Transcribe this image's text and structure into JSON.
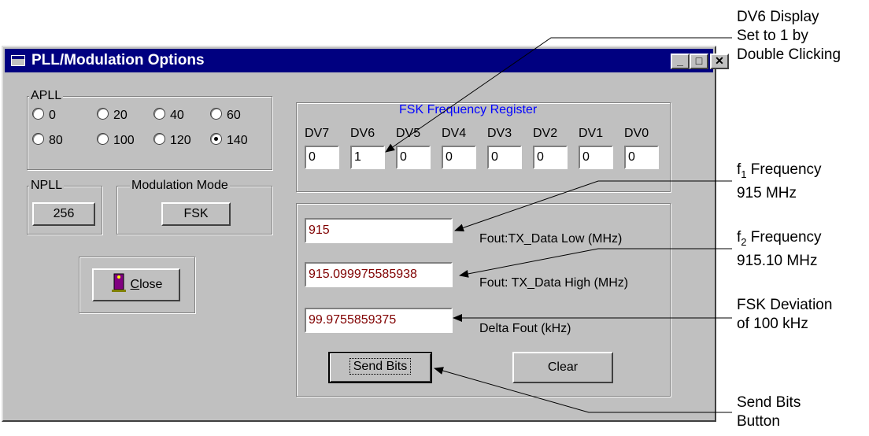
{
  "window": {
    "title": "PLL/Modulation Options"
  },
  "apll": {
    "label": "APLL",
    "options": [
      {
        "label": "0",
        "selected": false
      },
      {
        "label": "20",
        "selected": false
      },
      {
        "label": "40",
        "selected": false
      },
      {
        "label": "60",
        "selected": false
      },
      {
        "label": "80",
        "selected": false
      },
      {
        "label": "100",
        "selected": false
      },
      {
        "label": "120",
        "selected": false
      },
      {
        "label": "140",
        "selected": true
      }
    ]
  },
  "npll": {
    "label": "NPLL",
    "button": "256"
  },
  "modulation": {
    "label": "Modulation Mode",
    "button": "FSK"
  },
  "close_button": {
    "label": "Close",
    "mnemonic": "C",
    "rest": "lose"
  },
  "fsk_register": {
    "title": "FSK Frequency Register",
    "bits": [
      {
        "label": "DV7",
        "value": "0"
      },
      {
        "label": "DV6",
        "value": "1"
      },
      {
        "label": "DV5",
        "value": "0"
      },
      {
        "label": "DV4",
        "value": "0"
      },
      {
        "label": "DV3",
        "value": "0"
      },
      {
        "label": "DV2",
        "value": "0"
      },
      {
        "label": "DV1",
        "value": "0"
      },
      {
        "label": "DV0",
        "value": "0"
      }
    ]
  },
  "frequency": {
    "low": {
      "value": "915",
      "label": "Fout:TX_Data Low (MHz)"
    },
    "high": {
      "value": "915.099975585938",
      "label": "Fout: TX_Data High (MHz)"
    },
    "delta": {
      "value": "99.9755859375",
      "label": "Delta Fout (kHz)"
    }
  },
  "buttons": {
    "send_bits": "Send Bits",
    "clear": "Clear"
  },
  "annotations": {
    "dv6": [
      "DV6 Display",
      "Set to 1 by",
      "Double Clicking"
    ],
    "f1": {
      "prefix": "f",
      "sub": "1",
      "rest": " Frequency",
      "line2": "915 MHz"
    },
    "f2": {
      "prefix": "f",
      "sub": "2",
      "rest": " Frequency",
      "line2": "915.10 MHz"
    },
    "dev": [
      "FSK Deviation",
      "of 100 kHz"
    ],
    "send": [
      "Send Bits",
      "Button"
    ]
  },
  "colors": {
    "title_bar": "#000080",
    "register_title": "#0000ff",
    "value_text": "#800000"
  }
}
